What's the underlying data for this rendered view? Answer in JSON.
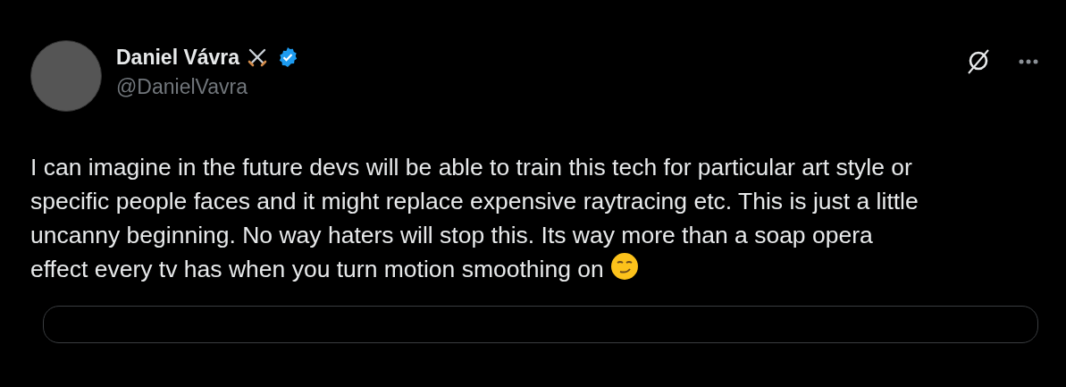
{
  "post": {
    "author": {
      "name": "Daniel Vávra",
      "verified": true,
      "handle": "@DanielVavra"
    },
    "text": "I can imagine in the future devs will be able to train this tech for particular art style or specific people faces and it might replace expensive raytracing etc. This is just a little uncanny beginning. No way haters will stop this. Its way more than a soap opera effect every tv has when you turn motion smoothing on"
  }
}
